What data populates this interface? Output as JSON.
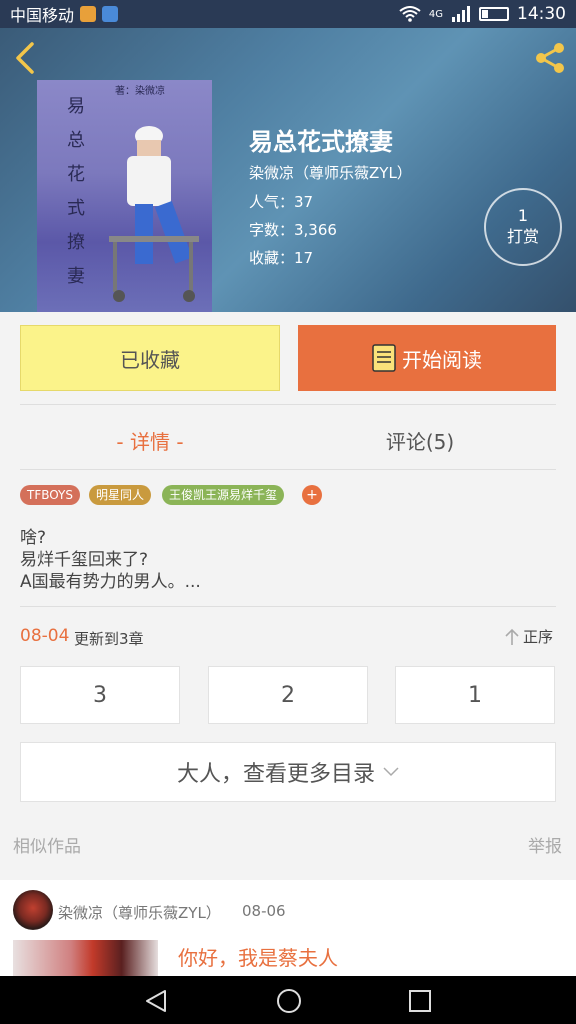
{
  "status_bar": {
    "carrier": "中国移动",
    "network": "4G",
    "time": "14:30",
    "battery_level": 0.25
  },
  "header": {
    "back_icon": "chevron-left-icon",
    "share_icon": "share-icon"
  },
  "book": {
    "cover_title": "易总花式撩妻",
    "cover_author": "著：染微凉",
    "title": "易总花式撩妻",
    "author": "染微凉（尊师乐薇ZYL）",
    "popularity": "人气：37",
    "word_count": "字数：3,366",
    "favorites": "收藏：17",
    "reward_count": "1",
    "reward_label": "打赏"
  },
  "actions": {
    "collect_label": "已收藏",
    "read_label": "开始阅读",
    "read_icon": "book-icon"
  },
  "tabs": {
    "details": "- 详情 -",
    "comments": "评论(5)"
  },
  "tags": [
    {
      "label": "TFBOYS",
      "color": "#d4705a"
    },
    {
      "label": "明星同人",
      "color": "#c99a3e"
    },
    {
      "label": "王俊凯王源易烊千玺",
      "color": "#8bb457"
    }
  ],
  "tag_add": "+",
  "description": {
    "line1": "啥?",
    "line2": "易烊千玺回来了?",
    "line3": "A国最有势力的男人。..."
  },
  "update": {
    "date": "08-04",
    "text": "更新到3章",
    "order_label": "正序"
  },
  "chapters": [
    "3",
    "2",
    "1"
  ],
  "more_catalog": "大人，查看更多目录",
  "similar_label": "相似作品",
  "report_label": "举报",
  "card": {
    "author": "染微凉（尊师乐薇ZYL）",
    "date": "08-06",
    "title": "你好，我是蔡夫人"
  },
  "colors": {
    "accent": "#e8703f",
    "collect_bg": "#fbf38a"
  }
}
